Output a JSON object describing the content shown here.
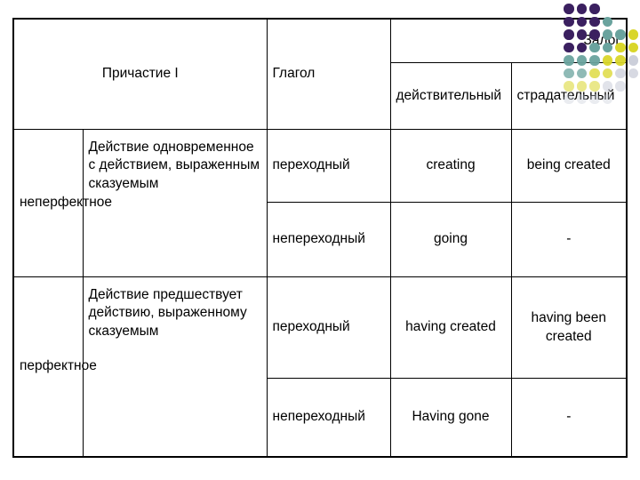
{
  "slide": {
    "background_color": "#ffffff",
    "decoration": {
      "name": "dot-grid-pattern",
      "colors": [
        "#3b2060",
        "#6aa39e",
        "#d9d62a",
        "#c9ccd8"
      ]
    }
  },
  "table": {
    "header": {
      "participle": "Причастие I",
      "verb": "Глагол",
      "voice": "Залог",
      "voice_active": "действительный",
      "voice_passive": "страдательный"
    },
    "rows": [
      {
        "aspect": "неперфектное",
        "meaning": "Действие одновременное с действием, выраженным сказуемым",
        "transitivity": [
          {
            "type": "переходный",
            "active": "creating",
            "passive": "being created"
          },
          {
            "type": "непереходный",
            "active": "going",
            "passive": "-"
          }
        ]
      },
      {
        "aspect": "перфектное",
        "meaning": "Действие предшествует действию, выраженному сказуемым",
        "transitivity": [
          {
            "type": "переходный",
            "active": "having created",
            "passive": "having been created"
          },
          {
            "type": "непереходный",
            "active": "Having gone",
            "passive": "-"
          }
        ]
      }
    ]
  }
}
